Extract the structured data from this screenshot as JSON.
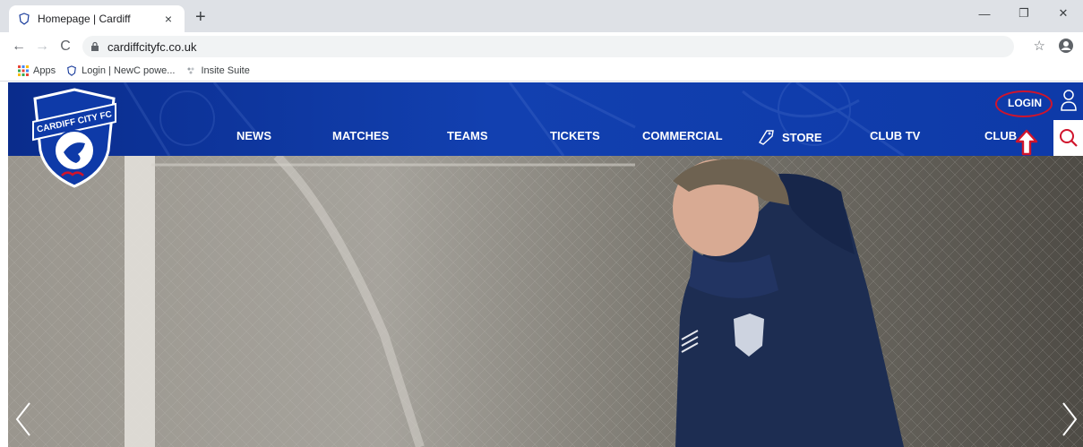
{
  "browser": {
    "tab_title": "Homepage | Cardiff",
    "tab_close": "×",
    "new_tab": "+",
    "url": "cardiffcityfc.co.uk",
    "bookmarks": [
      {
        "label": "Apps"
      },
      {
        "label": "Login | NewC powe..."
      },
      {
        "label": "Insite Suite"
      }
    ]
  },
  "site": {
    "crest_text": "CARDIFF CITY FC",
    "login_label": "LOGIN",
    "nav": [
      {
        "label": "NEWS"
      },
      {
        "label": "MATCHES"
      },
      {
        "label": "TEAMS"
      },
      {
        "label": "TICKETS"
      },
      {
        "label": "COMMERCIAL"
      },
      {
        "label": "STORE"
      },
      {
        "label": "CLUB TV"
      },
      {
        "label": "CLUB"
      }
    ],
    "colors": {
      "header_blue": "#0e3aa8",
      "highlight_red": "#d0142c"
    }
  }
}
